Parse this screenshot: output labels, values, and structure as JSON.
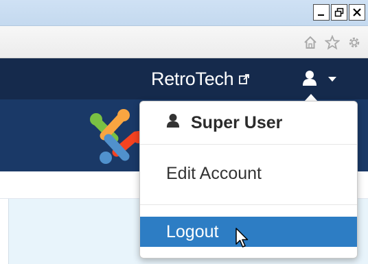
{
  "window": {
    "controls": [
      "minimize",
      "restore",
      "close"
    ]
  },
  "browser": {
    "icons": [
      "home-icon",
      "star-icon",
      "gear-icon"
    ]
  },
  "navbar": {
    "site_name": "RetroTech",
    "site_icon": "external-link-icon",
    "user_icon": "user-icon",
    "caret_icon": "caret-down-icon"
  },
  "header": {
    "logo": "joomla-logo"
  },
  "user_menu": {
    "header_label": "Super User",
    "items": [
      {
        "label": "Edit Account",
        "active": false
      },
      {
        "label": "Logout",
        "active": true
      }
    ]
  },
  "colors": {
    "navbar": "#152a4c",
    "header": "#1a3967",
    "highlight": "#2d7dc4",
    "content_bg": "#e8f4fb"
  }
}
